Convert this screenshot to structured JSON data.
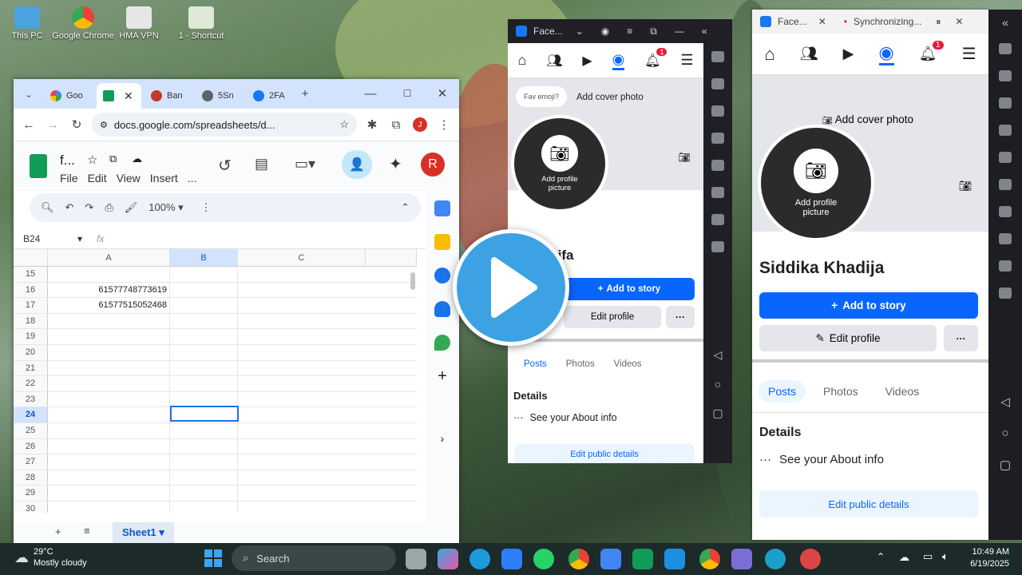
{
  "desktop": {
    "icons": [
      {
        "label": "This PC"
      },
      {
        "label": "Google Chrome"
      },
      {
        "label": "HMA VPN"
      },
      {
        "label": "1 - Shortcut"
      }
    ]
  },
  "sheets_window": {
    "tabs": [
      {
        "label": "Goo"
      },
      {
        "label": ""
      },
      {
        "label": "Ban"
      },
      {
        "label": "5Sn"
      },
      {
        "label": "2FA"
      }
    ],
    "url": "docs.google.com/spreadsheets/d...",
    "profile_letter": "J",
    "doc_title": "f...",
    "menu": [
      "File",
      "Edit",
      "View",
      "Insert",
      "..."
    ],
    "account_letter": "R",
    "zoom": "100%",
    "cell_ref": "B24",
    "fx": "fx",
    "columns": [
      "A",
      "B",
      "C"
    ],
    "rows": [
      {
        "n": "15",
        "a": ""
      },
      {
        "n": "16",
        "a": "61577748773619"
      },
      {
        "n": "17",
        "a": "61577515052468"
      },
      {
        "n": "18",
        "a": ""
      },
      {
        "n": "19",
        "a": ""
      },
      {
        "n": "20",
        "a": ""
      },
      {
        "n": "21",
        "a": ""
      },
      {
        "n": "22",
        "a": ""
      },
      {
        "n": "23",
        "a": ""
      },
      {
        "n": "24",
        "a": ""
      },
      {
        "n": "25",
        "a": ""
      },
      {
        "n": "26",
        "a": ""
      },
      {
        "n": "27",
        "a": ""
      },
      {
        "n": "28",
        "a": ""
      },
      {
        "n": "29",
        "a": ""
      },
      {
        "n": "30",
        "a": ""
      }
    ],
    "sheet_tab": "Sheet1"
  },
  "fb_small": {
    "tab_label": "Face...",
    "notif_count": "1",
    "fav_emoji": "Fav emoji?",
    "cover_label": "Add cover photo",
    "avatar_label": "Add profile picture",
    "name": "...a Arifa",
    "add_story": "Add to story",
    "edit_profile": "Edit profile",
    "more": "···",
    "tabs": [
      "Posts",
      "Photos",
      "Videos"
    ],
    "details": "Details",
    "about": "See your About info",
    "edit_details": "Edit public details"
  },
  "fb_large": {
    "tab_label": "Face...",
    "sync_label": "Synchronizing...",
    "notif_count": "1",
    "cover_label": "Add cover photo",
    "avatar_label": "Add profile picture",
    "name": "Siddika Khadija",
    "add_story": "Add to story",
    "edit_profile": "Edit profile",
    "more": "···",
    "tabs": [
      "Posts",
      "Photos",
      "Videos"
    ],
    "details": "Details",
    "about": "See your About info",
    "edit_details": "Edit public details"
  },
  "taskbar": {
    "temp": "29°C",
    "weather": "Mostly cloudy",
    "search": "Search",
    "time": "10:49 AM",
    "date": "6/19/2025"
  }
}
